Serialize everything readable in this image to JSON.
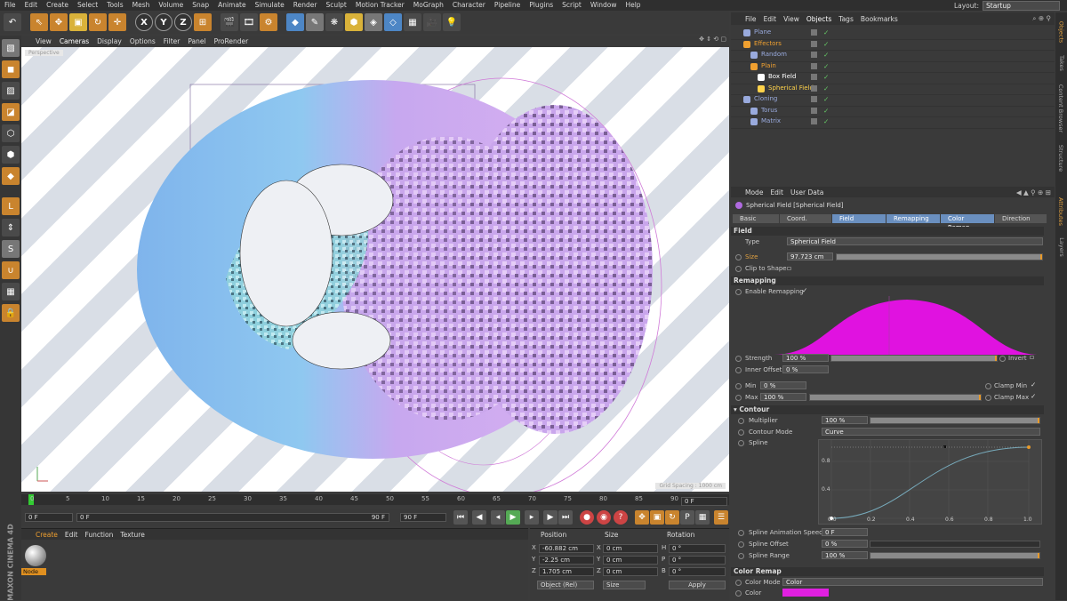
{
  "menubar": {
    "items": [
      "File",
      "Edit",
      "Create",
      "Select",
      "Tools",
      "Mesh",
      "Volume",
      "Snap",
      "Animate",
      "Simulate",
      "Render",
      "Sculpt",
      "Motion Tracker",
      "MoGraph",
      "Character",
      "Pipeline",
      "Plugins",
      "Script",
      "Window",
      "Help"
    ],
    "highlight": [
      false,
      false,
      false,
      false,
      false,
      false,
      false,
      false,
      false,
      false,
      false,
      false,
      false,
      false,
      false,
      false,
      false,
      false,
      false,
      false
    ],
    "layout_label": "Layout:",
    "layout_value": "Startup"
  },
  "viewport": {
    "menu": [
      "View",
      "Cameras",
      "Display",
      "Options",
      "Filter",
      "Panel",
      "ProRender"
    ],
    "label": "Perspective",
    "grid": "Grid Spacing : 1000 cm"
  },
  "timeline": {
    "ticks": [
      "0",
      "5",
      "10",
      "15",
      "20",
      "25",
      "30",
      "35",
      "40",
      "45",
      "50",
      "55",
      "60",
      "65",
      "70",
      "75",
      "80",
      "85",
      "90"
    ],
    "current_frame": "0 F",
    "start": "0 F",
    "range_start": "0 F",
    "range_end": "90 F",
    "end": "90 F"
  },
  "material_manager": {
    "menu": [
      "Create",
      "Edit",
      "Function",
      "Texture"
    ],
    "material_name": "Node",
    "logo": "MAXON CINEMA 4D"
  },
  "coordinates": {
    "headers": [
      "Position",
      "Size",
      "Rotation"
    ],
    "rows": [
      {
        "pl": "X",
        "pv": "-60.882 cm",
        "sl": "X",
        "sv": "0 cm",
        "rl": "H",
        "rv": "0 °"
      },
      {
        "pl": "Y",
        "pv": "-2.25 cm",
        "sl": "Y",
        "sv": "0 cm",
        "rl": "P",
        "rv": "0 °"
      },
      {
        "pl": "Z",
        "pv": "1.705 cm",
        "sl": "Z",
        "sv": "0 cm",
        "rl": "B",
        "rv": "0 °"
      }
    ],
    "mode": "Object (Rel)",
    "size_mode": "Size",
    "apply": "Apply"
  },
  "object_manager": {
    "menu": [
      "File",
      "Edit",
      "View",
      "Objects",
      "Tags",
      "Bookmarks"
    ],
    "objects": [
      {
        "name": "Plane",
        "indent": 0,
        "color": "#9ad"
      },
      {
        "name": "Effectors",
        "indent": 0,
        "color": "#f0a030"
      },
      {
        "name": "Random",
        "indent": 1,
        "color": "#9ad"
      },
      {
        "name": "Plain",
        "indent": 1,
        "color": "#f0a030"
      },
      {
        "name": "Box Field",
        "indent": 2,
        "color": "#fff"
      },
      {
        "name": "Spherical Field",
        "indent": 2,
        "color": "#ffd24a"
      },
      {
        "name": "Cloning",
        "indent": 0,
        "color": "#9ad"
      },
      {
        "name": "Torus",
        "indent": 1,
        "color": "#9ad"
      },
      {
        "name": "Matrix",
        "indent": 1,
        "color": "#9ad"
      }
    ]
  },
  "right_tabs": [
    "Objects",
    "Takes",
    "Content Browser",
    "Structure",
    "Attributes",
    "Layers"
  ],
  "attributes": {
    "menu": [
      "Mode",
      "Edit",
      "User Data"
    ],
    "title": "Spherical Field [Spherical Field]",
    "tabs": [
      "Basic",
      "Coord.",
      "Field",
      "Remapping",
      "Color Remap",
      "Direction"
    ],
    "field_section": "Field",
    "type_label": "Type",
    "type_value": "Spherical Field",
    "size_label": "Size",
    "size_value": "97.723 cm",
    "clip_label": "Clip to Shape",
    "remap_section": "Remapping",
    "enable_remap_label": "Enable Remapping",
    "strength_label": "Strength",
    "strength_value": "100 %",
    "invert_label": "Invert",
    "inner_offset_label": "Inner Offset",
    "inner_offset_value": "0 %",
    "min_label": "Min",
    "min_value": "0 %",
    "clamp_min_label": "Clamp Min",
    "max_label": "Max",
    "max_value": "100 %",
    "clamp_max_label": "Clamp Max",
    "contour_section": "Contour",
    "multiplier_label": "Multiplier",
    "multiplier_value": "100 %",
    "contour_mode_label": "Contour Mode",
    "contour_mode_value": "Curve",
    "spline_label": "Spline",
    "spline_y": [
      "0.8",
      "0.4"
    ],
    "spline_x": [
      "0.0",
      "0.2",
      "0.4",
      "0.6",
      "0.8",
      "1.0"
    ],
    "spline_anim_label": "Spline Animation Speed",
    "spline_anim_value": "0 F",
    "spline_offset_label": "Spline Offset",
    "spline_offset_value": "0 %",
    "spline_range_label": "Spline Range",
    "spline_range_value": "100 %",
    "color_remap_section": "Color Remap",
    "color_mode_label": "Color Mode",
    "color_mode_value": "Color",
    "color_label": "Color",
    "color_swatch": "#e020e0"
  }
}
